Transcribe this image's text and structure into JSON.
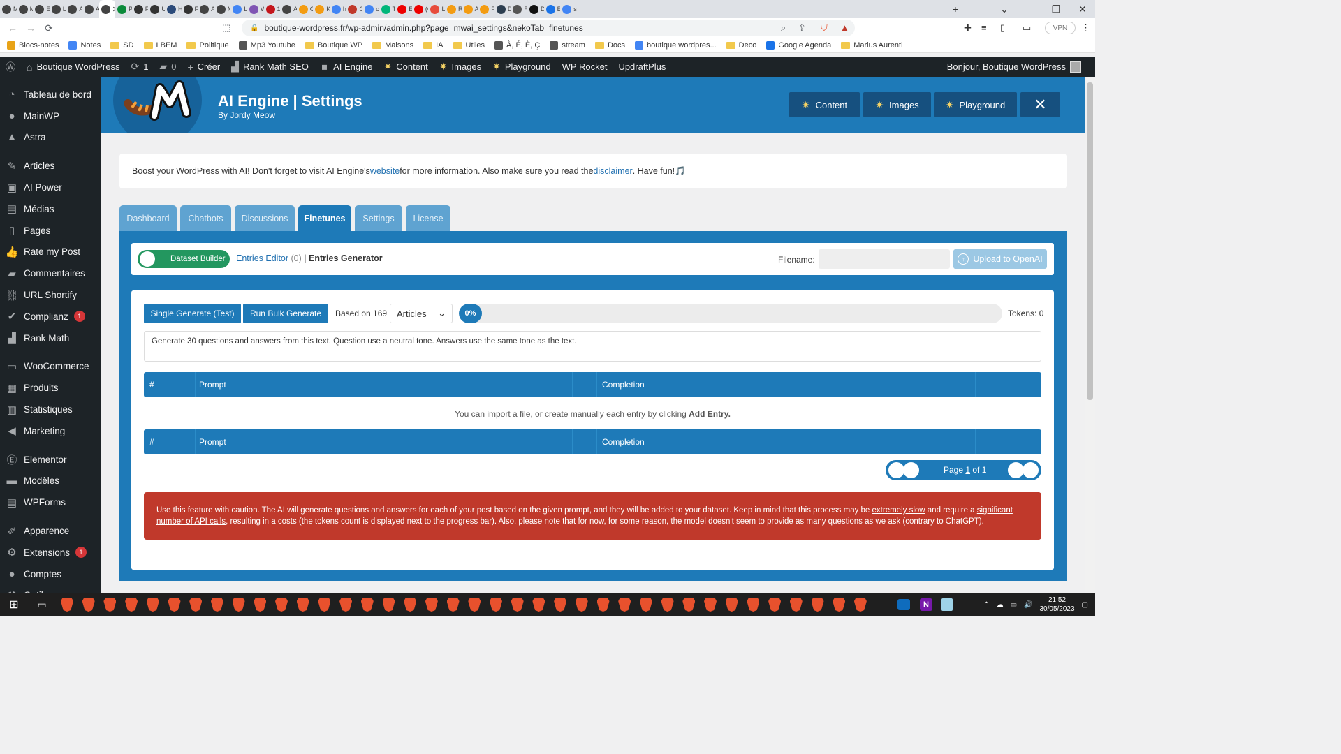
{
  "browser": {
    "tabs": [
      {
        "label": "Mc",
        "color": "#444"
      },
      {
        "label": "Mc",
        "color": "#444"
      },
      {
        "label": "Ext",
        "color": "#444"
      },
      {
        "label": "Le",
        "color": "#444"
      },
      {
        "label": "AI",
        "color": "#444"
      },
      {
        "label": "AI",
        "color": "#444"
      },
      {
        "label": "",
        "color": "#444",
        "active": true
      },
      {
        "label": "Pri",
        "color": "#0a8a3a"
      },
      {
        "label": "Fir",
        "color": "#333"
      },
      {
        "label": "Us",
        "color": "#333"
      },
      {
        "label": "Ho",
        "color": "#2b4a7a"
      },
      {
        "label": "Fir",
        "color": "#333"
      },
      {
        "label": "AI",
        "color": "#444"
      },
      {
        "label": "Mc",
        "color": "#444"
      },
      {
        "label": "Le",
        "color": "#4285f4"
      },
      {
        "label": "Wc",
        "color": "#7f54b3"
      },
      {
        "label": "15",
        "color": "#c4161c"
      },
      {
        "label": "AI",
        "color": "#444"
      },
      {
        "label": "Co",
        "color": "#f39c12"
      },
      {
        "label": "Ke",
        "color": "#f39c12"
      },
      {
        "label": "htt",
        "color": "#4285f4"
      },
      {
        "label": "Ou",
        "color": "#c0392b"
      },
      {
        "label": "co",
        "color": "#4285f4"
      },
      {
        "label": "Tru",
        "color": "#00b67a"
      },
      {
        "label": "E-",
        "color": "#e00"
      },
      {
        "label": "(G",
        "color": "#e00"
      },
      {
        "label": "Lu",
        "color": "#e74c3c"
      },
      {
        "label": "Ré",
        "color": "#f39c12"
      },
      {
        "label": "Ap",
        "color": "#f39c12"
      },
      {
        "label": "Fa",
        "color": "#f39c12"
      },
      {
        "label": "De",
        "color": "#2c3e50"
      },
      {
        "label": "Ré",
        "color": "#555"
      },
      {
        "label": "De",
        "color": "#111"
      },
      {
        "label": "Eta",
        "color": "#1a73e8"
      },
      {
        "label": "ser",
        "color": "#4285f4"
      }
    ],
    "url": "boutique-wordpress.fr/wp-admin/admin.php?page=mwai_settings&nekoTab=finetunes",
    "vpn_label": "VPN",
    "bookmarks": [
      {
        "label": "Blocs-notes",
        "kind": "app"
      },
      {
        "label": "Notes",
        "kind": "doc"
      },
      {
        "label": "SD",
        "kind": "folder"
      },
      {
        "label": "LBEM",
        "kind": "folder"
      },
      {
        "label": "Politique",
        "kind": "folder"
      },
      {
        "label": "Mp3 Youtube",
        "kind": "site"
      },
      {
        "label": "Boutique WP",
        "kind": "folder"
      },
      {
        "label": "Maisons",
        "kind": "folder"
      },
      {
        "label": "IA",
        "kind": "folder"
      },
      {
        "label": "Utiles",
        "kind": "folder"
      },
      {
        "label": "À, É, È, Ç",
        "kind": "site"
      },
      {
        "label": "stream",
        "kind": "site"
      },
      {
        "label": "Docs",
        "kind": "folder"
      },
      {
        "label": "boutique wordpres...",
        "kind": "google"
      },
      {
        "label": "Deco",
        "kind": "folder"
      },
      {
        "label": "Google Agenda",
        "kind": "calendar"
      },
      {
        "label": "Marius Aurenti",
        "kind": "folder"
      }
    ]
  },
  "adminbar": {
    "site_name": "Boutique WordPress",
    "updates_count": "1",
    "comments_count": "0",
    "new_label": "Créer",
    "items": [
      "Rank Math SEO",
      "AI Engine",
      "Content",
      "Images",
      "Playground",
      "WP Rocket",
      "UpdraftPlus"
    ],
    "greeting": "Bonjour, Boutique WordPress"
  },
  "sidebar": {
    "groups": [
      [
        {
          "label": "Tableau de bord",
          "icon": "dashboard-icon",
          "glyph": "◔"
        },
        {
          "label": "MainWP",
          "icon": "mainwp-icon",
          "glyph": "●"
        },
        {
          "label": "Astra",
          "icon": "astra-icon",
          "glyph": "▲"
        }
      ],
      [
        {
          "label": "Articles",
          "icon": "pin-icon",
          "glyph": "✎"
        },
        {
          "label": "AI Power",
          "icon": "ai-power-icon",
          "glyph": "▣"
        },
        {
          "label": "Médias",
          "icon": "media-icon",
          "glyph": "▤"
        },
        {
          "label": "Pages",
          "icon": "pages-icon",
          "glyph": "▯"
        },
        {
          "label": "Rate my Post",
          "icon": "thumbs-up-icon",
          "glyph": "👍"
        },
        {
          "label": "Commentaires",
          "icon": "comments-icon",
          "glyph": "▰"
        },
        {
          "label": "URL Shortify",
          "icon": "link-icon",
          "glyph": "⛓"
        },
        {
          "label": "Complianz",
          "icon": "check-icon",
          "glyph": "✔",
          "badge": "1"
        },
        {
          "label": "Rank Math",
          "icon": "rank-math-icon",
          "glyph": "▟"
        }
      ],
      [
        {
          "label": "WooCommerce",
          "icon": "woocommerce-icon",
          "glyph": "▭"
        },
        {
          "label": "Produits",
          "icon": "products-icon",
          "glyph": "▦"
        },
        {
          "label": "Statistiques",
          "icon": "stats-icon",
          "glyph": "▥"
        },
        {
          "label": "Marketing",
          "icon": "megaphone-icon",
          "glyph": "◀"
        }
      ],
      [
        {
          "label": "Elementor",
          "icon": "elementor-icon",
          "glyph": "Ⓔ"
        },
        {
          "label": "Modèles",
          "icon": "folder-icon",
          "glyph": "▬"
        },
        {
          "label": "WPForms",
          "icon": "forms-icon",
          "glyph": "▤"
        }
      ],
      [
        {
          "label": "Apparence",
          "icon": "brush-icon",
          "glyph": "✐"
        },
        {
          "label": "Extensions",
          "icon": "plugin-icon",
          "glyph": "⚙",
          "badge": "1"
        },
        {
          "label": "Comptes",
          "icon": "user-icon",
          "glyph": "●"
        },
        {
          "label": "Outils",
          "icon": "tools-icon",
          "glyph": "⚒"
        }
      ]
    ]
  },
  "header": {
    "title": "AI Engine | Settings",
    "subtitle": "By Jordy Meow",
    "buttons": [
      "Content",
      "Images",
      "Playground"
    ]
  },
  "notice": {
    "text1": "Boost your WordPress with AI! Don't forget to visit AI Engine's ",
    "link1": "website",
    "text2": " for more information. Also make sure you read the ",
    "link2": "disclaimer",
    "text3": ". Have fun! ",
    "emoji": "🎵"
  },
  "tabs": [
    {
      "label": "Dashboard"
    },
    {
      "label": "Chatbots"
    },
    {
      "label": "Discussions"
    },
    {
      "label": "Finetunes",
      "active": true
    },
    {
      "label": "Settings"
    },
    {
      "label": "License"
    }
  ],
  "finetunes": {
    "toggle_label": "Dataset Builder",
    "entries_editor": "Entries Editor",
    "entries_count": "(0)",
    "separator": "|",
    "entries_generator": "Entries Generator",
    "filename_label": "Filename:",
    "filename_value": "",
    "upload_label": "Upload to OpenAI",
    "single_generate": "Single Generate (Test)",
    "run_bulk": "Run Bulk Generate",
    "based_on": "Based on 169",
    "post_type": "Articles",
    "progress": 0,
    "progress_label": "0%",
    "tokens": "Tokens: 0",
    "prompt": "Generate 30 questions and answers from this text. Question use a neutral tone. Answers use the same tone as the text.",
    "table_headers": {
      "num": "#",
      "prompt": "Prompt",
      "completion": "Completion"
    },
    "empty_text": "You can import a file, or create manually each entry by clicking ",
    "empty_bold": "Add Entry.",
    "pager_text_pre": "Page ",
    "pager_page": "1",
    "pager_text_post": " of 1",
    "warning": {
      "t1": "Use this feature with caution. The AI will generate questions and answers for each of your post based on the given prompt, and they will be added to your dataset. Keep in mind that this process may be ",
      "u1": "extremely slow",
      "t2": " and require a ",
      "u2": "significant number of API calls",
      "t3": ", resulting in a costs (the tokens count is displayed next to the progress bar). Also, please note that for now, for some reason, the model doesn't seem to provide as many questions as we ask (contrary to ChatGPT)."
    }
  },
  "taskbar": {
    "time": "21:52",
    "date": "30/05/2023",
    "brave_count": 38
  },
  "colors": {
    "accent": "#1e7ab8",
    "toggle_green": "#23975f",
    "warning_red": "#c0392b",
    "wp_dark": "#1d2327"
  }
}
